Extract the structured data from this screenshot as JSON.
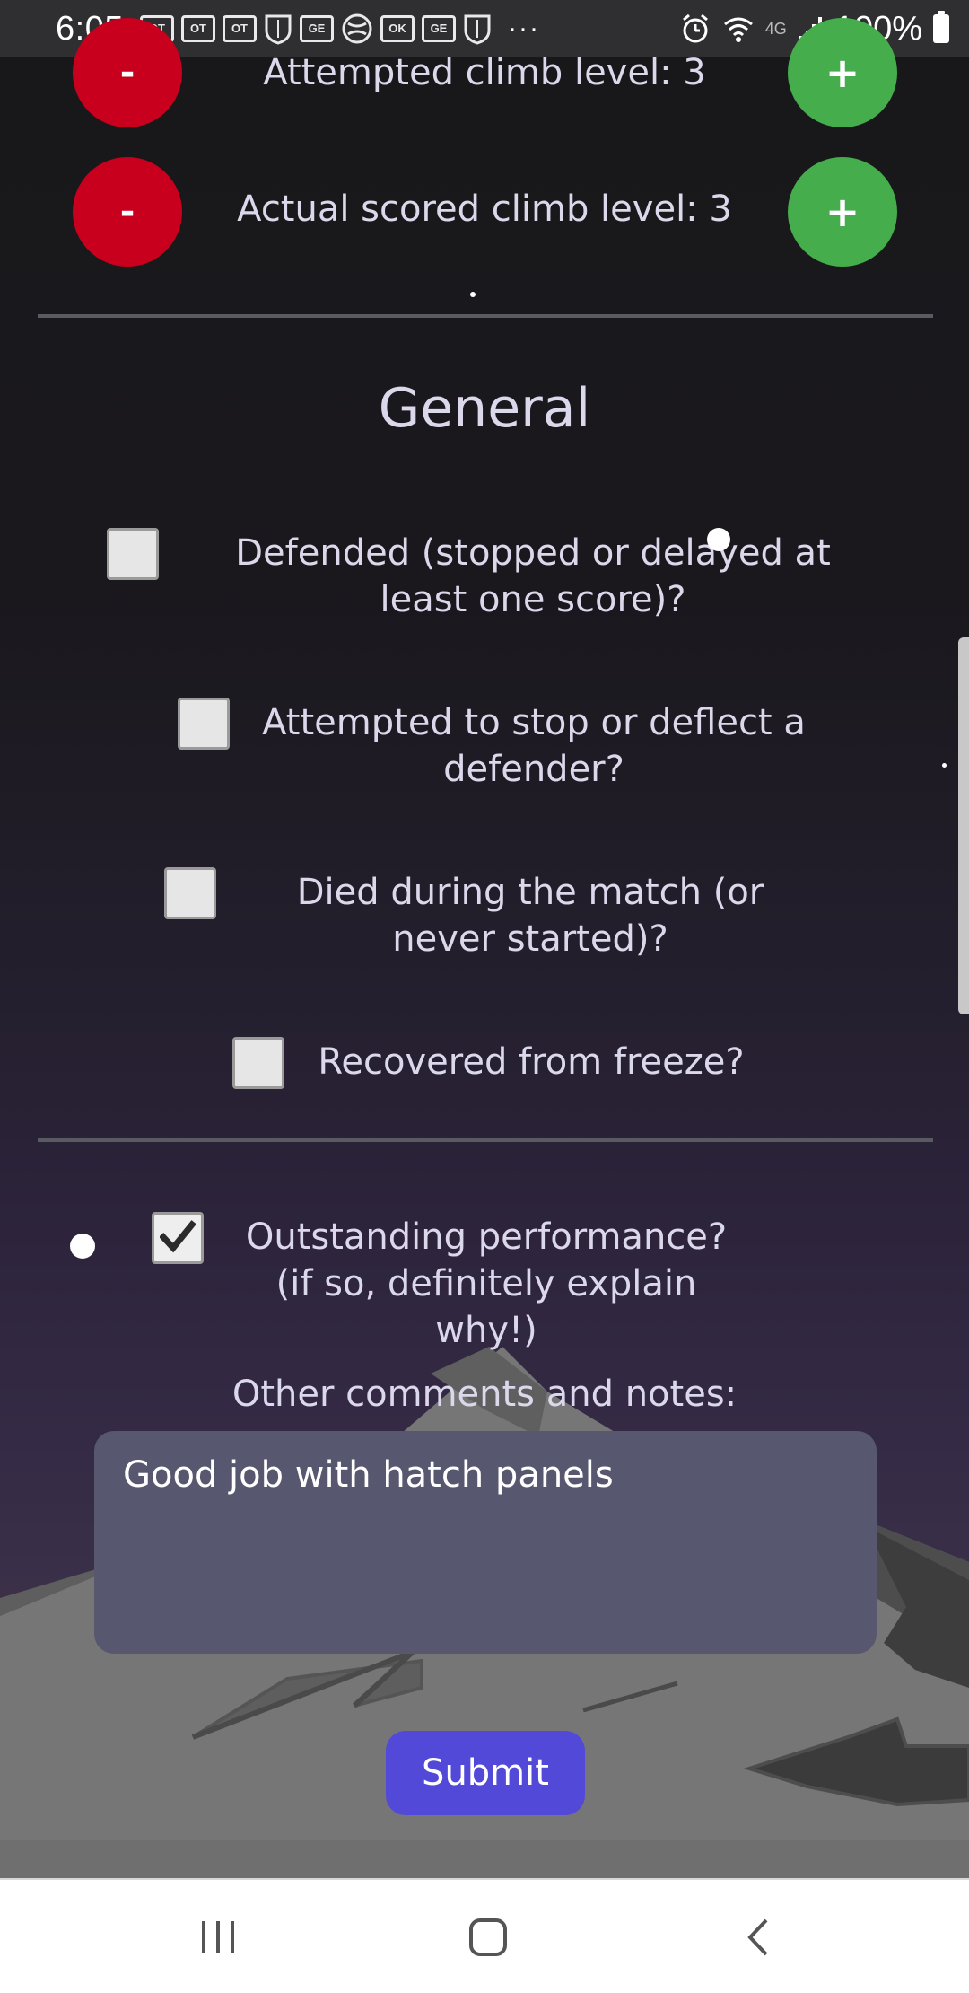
{
  "status_bar": {
    "time": "6:05",
    "more": "···",
    "network": "4G",
    "battery": "100%",
    "notification_icons": [
      "OT",
      "OT",
      "OT",
      "shield",
      "GE",
      "circle",
      "OK",
      "GE",
      "shield"
    ]
  },
  "climb": {
    "attempted_label": "Attempted climb level: 3",
    "actual_label": "Actual scored climb level: 3",
    "minus_label": "-",
    "plus_label": "+"
  },
  "general": {
    "title": "General",
    "checkboxes": [
      {
        "label": "Defended (stopped or delayed at least one score)?",
        "checked": false
      },
      {
        "label": "Attempted to stop or deflect a defender?",
        "checked": false
      },
      {
        "label": "Died during the match (or never started)?",
        "checked": false
      },
      {
        "label": "Recovered from freeze?",
        "checked": false
      }
    ],
    "outstanding": {
      "label": "Outstanding performance? (if so, definitely explain why!)",
      "checked": true
    }
  },
  "comments": {
    "label": "Other comments and notes:",
    "value": "Good job with hatch panels"
  },
  "submit_label": "Submit",
  "nav": {
    "recents_icon": "recents-icon",
    "home_icon": "home-icon",
    "back_icon": "back-icon"
  },
  "colors": {
    "minus_button": "#c8001e",
    "plus_button": "#45ad4c",
    "submit_button": "#5249d8",
    "text": "#dcd8ec",
    "textarea": "#575770"
  }
}
